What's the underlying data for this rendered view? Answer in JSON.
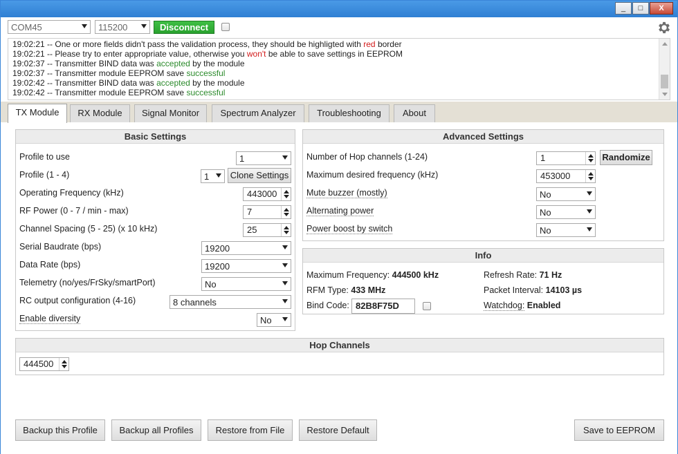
{
  "window": {
    "min": "_",
    "max": "□",
    "close": "X"
  },
  "connection": {
    "port": "COM45",
    "baud": "115200",
    "disconnect_label": "Disconnect"
  },
  "log": [
    {
      "time": "19:02:21",
      "parts": [
        [
          "-- One or more fields didn't pass the validation process, they should be highligted with ",
          ""
        ],
        [
          "red",
          "red"
        ],
        [
          " border",
          ""
        ]
      ]
    },
    {
      "time": "19:02:21",
      "parts": [
        [
          "-- Please try to enter appropriate value, otherwise you ",
          ""
        ],
        [
          "won't",
          "red"
        ],
        [
          " be able to save settings in EEPROM",
          ""
        ]
      ]
    },
    {
      "time": "19:02:37",
      "parts": [
        [
          "-- Transmitter BIND data was ",
          ""
        ],
        [
          "accepted",
          "green"
        ],
        [
          " by the module",
          ""
        ]
      ]
    },
    {
      "time": "19:02:37",
      "parts": [
        [
          "-- Transmitter module EEPROM save ",
          ""
        ],
        [
          "successful",
          "green"
        ]
      ]
    },
    {
      "time": "19:02:42",
      "parts": [
        [
          "-- Transmitter BIND data was ",
          ""
        ],
        [
          "accepted",
          "green"
        ],
        [
          " by the module",
          ""
        ]
      ]
    },
    {
      "time": "19:02:42",
      "parts": [
        [
          "-- Transmitter module EEPROM save ",
          ""
        ],
        [
          "successful",
          "green"
        ]
      ]
    }
  ],
  "tabs": [
    "TX Module",
    "RX Module",
    "Signal Monitor",
    "Spectrum Analyzer",
    "Troubleshooting",
    "About"
  ],
  "basic": {
    "title": "Basic Settings",
    "profile_to_use_label": "Profile to use",
    "profile_to_use": "1",
    "profile_label": "Profile (1 - 4)",
    "profile": "1",
    "clone_label": "Clone Settings",
    "freq_label": "Operating Frequency (kHz)",
    "freq": "443000",
    "rfpower_label": "RF Power (0 - 7 / min - max)",
    "rfpower": "7",
    "spacing_label": "Channel Spacing (5 - 25) (x 10 kHz)",
    "spacing": "25",
    "serial_label": "Serial Baudrate (bps)",
    "serial": "19200",
    "datarate_label": "Data Rate (bps)",
    "datarate": "19200",
    "telemetry_label": "Telemetry (no/yes/FrSky/smartPort)",
    "telemetry": "No",
    "rcout_label": "RC output configuration (4-16)",
    "rcout": "8 channels",
    "diversity_label": "Enable diversity",
    "diversity": "No"
  },
  "advanced": {
    "title": "Advanced Settings",
    "hops_label": "Number of Hop channels (1-24)",
    "hops": "1",
    "randomize_label": "Randomize",
    "maxfreq_label": "Maximum desired frequency (kHz)",
    "maxfreq": "453000",
    "mute_label": "Mute buzzer (mostly)",
    "mute": "No",
    "altpower_label": "Alternating power",
    "altpower": "No",
    "boost_label": "Power boost by switch",
    "boost": "No"
  },
  "info": {
    "title": "Info",
    "maxfreq_label": "Maximum Frequency:",
    "maxfreq": "444500 kHz",
    "refresh_label": "Refresh Rate:",
    "refresh": "71 Hz",
    "rfm_label": "RFM Type:",
    "rfm": "433 MHz",
    "packet_label": "Packet Interval:",
    "packet": "14103 µs",
    "bind_label": "Bind Code:",
    "bind": "82B8F75D",
    "watchdog_label": "Watchdog:",
    "watchdog": "Enabled"
  },
  "hop": {
    "title": "Hop Channels",
    "ch1": "444500"
  },
  "bottom": {
    "backup_profile": "Backup this Profile",
    "backup_all": "Backup all Profiles",
    "restore_file": "Restore from File",
    "restore_default": "Restore Default",
    "save": "Save to EEPROM"
  }
}
